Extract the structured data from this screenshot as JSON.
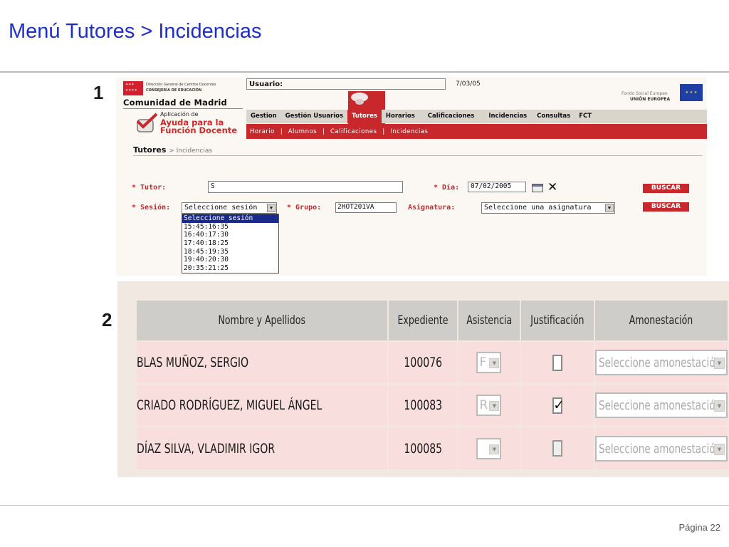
{
  "slide": {
    "title": "Menú Tutores > Incidencias",
    "step1": "1",
    "step2": "2",
    "page_label": "Página 22"
  },
  "header": {
    "brand_dir": "Dirección General de Centros Docentes",
    "brand_cons": "CONSEJERÍA DE EDUCACIÓN",
    "brand_name": "Comunidad de Madrid",
    "app_small": "Aplicación de",
    "app_big1": "Ayuda para la",
    "app_big2": "Función Docente",
    "user_label": "Usuario:",
    "date": "7/03/05",
    "fse_line1": "Fondo Social Europeo",
    "fse_line2": "UNIÓN EUROPEA"
  },
  "menu": {
    "items": [
      {
        "label": "Gestion",
        "active": false
      },
      {
        "label": "Gestión Usuarios",
        "active": false
      },
      {
        "label": "Tutores",
        "active": true
      },
      {
        "label": "Horarios",
        "active": false
      },
      {
        "label": "Calificaciones",
        "active": false
      },
      {
        "label": "Incidencias",
        "active": false
      },
      {
        "label": "Consultas",
        "active": false
      },
      {
        "label": "FCT",
        "active": false
      }
    ],
    "sub_items": [
      "Horario",
      "Alumnos",
      "Calificaciones",
      "Incidencias"
    ]
  },
  "breadcrumb": {
    "root": "Tutores",
    "rest": "> Incidencias"
  },
  "form": {
    "tutor_label": "* Tutor:",
    "tutor_value": "S",
    "dia_label": "* Día:",
    "dia_value": "07/02/2005",
    "buscar1": "BUSCAR",
    "sesion_label": "* Sesión:",
    "sesion_value": "Seleccione sesión",
    "grupo_label": "* Grupo:",
    "grupo_value": "2HOT201VA",
    "asignatura_label": "Asignatura:",
    "asignatura_value": "Seleccione una asignatura",
    "buscar2": "BUSCAR",
    "sesion_options": [
      "Seleccione sesión",
      "15:45:16:35",
      "16:40:17:30",
      "17:40:18:25",
      "18:45:19:35",
      "19:40:20:30",
      "20:35:21:25"
    ]
  },
  "table": {
    "headers": [
      "Nombre y Apellidos",
      "Expediente",
      "Asistencia",
      "Justificación",
      "Amonestación"
    ],
    "amonestacion_placeholder": "Seleccione amonestación",
    "rows": [
      {
        "name": "BLAS MUÑOZ, SERGIO",
        "expediente": "100076",
        "asistencia": "F",
        "justificado": false,
        "disabled": false
      },
      {
        "name": "CRIADO RODRÍGUEZ, MIGUEL ÁNGEL",
        "expediente": "100083",
        "asistencia": "R",
        "justificado": true,
        "disabled": false
      },
      {
        "name": "DÍAZ SILVA, VLADIMIR IGOR",
        "expediente": "100085",
        "asistencia": "",
        "justificado": false,
        "disabled": true
      }
    ]
  },
  "colors": {
    "title_blue": "#1e2fc8",
    "brand_red": "#c8282c",
    "header_gray": "#cfcdc9",
    "row_pink": "#f8dfdd"
  }
}
